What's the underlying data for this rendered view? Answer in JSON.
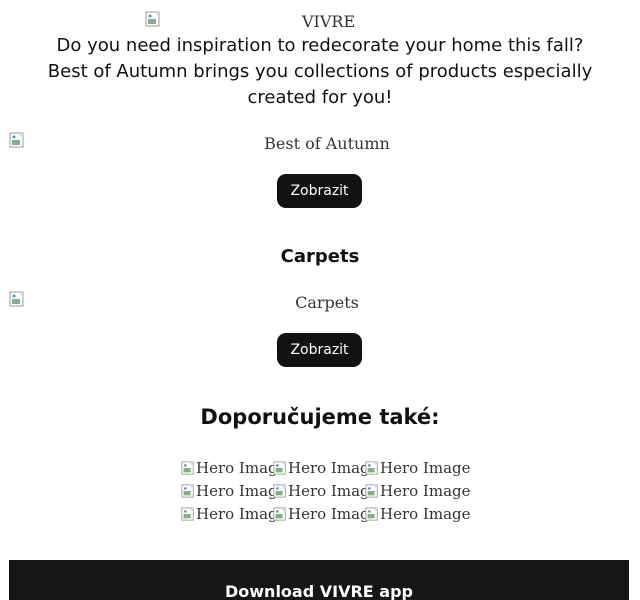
{
  "header": {
    "logo_alt": "VIVRE"
  },
  "intro": {
    "text": "Do you need inspiration to redecorate your home this fall? Best of Autumn brings you collections of products especially created for you!"
  },
  "sections": [
    {
      "title": "",
      "image_alt": "Best of Autumn",
      "button_label": "Zobrazit"
    },
    {
      "title": "Carpets",
      "image_alt": "Carpets",
      "button_label": "Zobrazit"
    }
  ],
  "recommended": {
    "title": "Doporučujeme také:",
    "images": [
      [
        "Hero Image",
        "Hero Image",
        "Hero Image"
      ],
      [
        "Hero Image",
        "Hero Image",
        "Hero Image"
      ],
      [
        "Hero Image",
        "Hero Image",
        "Hero Image"
      ]
    ]
  },
  "footer": {
    "title": "Download VIVRE app"
  },
  "colors": {
    "button_bg": "#121212",
    "footer_bg": "#161616",
    "text": "#111111"
  },
  "icons": {
    "broken_image": "broken-image-icon"
  }
}
